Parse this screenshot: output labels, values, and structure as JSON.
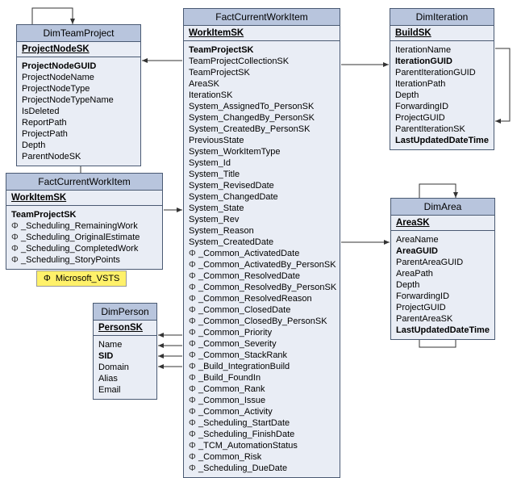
{
  "entities": {
    "dimTeamProject": {
      "title": "DimTeamProject",
      "pk": "ProjectNodeSK",
      "fields": [
        {
          "name": "ProjectNodeGUID",
          "bold": true
        },
        {
          "name": "ProjectNodeName"
        },
        {
          "name": "ProjectNodeType"
        },
        {
          "name": "ProjectNodeTypeName"
        },
        {
          "name": "IsDeleted"
        },
        {
          "name": "ReportPath"
        },
        {
          "name": "ProjectPath"
        },
        {
          "name": "Depth"
        },
        {
          "name": "ParentNodeSK"
        }
      ]
    },
    "factCurrentWorkItemSmall": {
      "title": "FactCurrentWorkItem",
      "pk": "WorkItemSK",
      "header2": "TeamProjectSK",
      "fields": [
        {
          "phi": true,
          "name": "_Scheduling_RemainingWork"
        },
        {
          "phi": true,
          "name": "_Scheduling_OriginalEstimate"
        },
        {
          "phi": true,
          "name": "_Scheduling_CompletedWork"
        },
        {
          "phi": true,
          "name": "_Scheduling_StoryPoints"
        }
      ]
    },
    "factCurrentWorkItemLarge": {
      "title": "FactCurrentWorkItem",
      "pk": "WorkItemSK",
      "header2": "TeamProjectSK",
      "fields": [
        {
          "name": "TeamProjectCollectionSK"
        },
        {
          "name": "TeamProjectSK"
        },
        {
          "name": "AreaSK"
        },
        {
          "name": "IterationSK"
        },
        {
          "name": "System_AssignedTo_PersonSK"
        },
        {
          "name": "System_ChangedBy_PersonSK"
        },
        {
          "name": "System_CreatedBy_PersonSK"
        },
        {
          "name": "PreviousState"
        },
        {
          "name": "System_WorkItemType"
        },
        {
          "name": "System_Id"
        },
        {
          "name": "System_Title"
        },
        {
          "name": "System_RevisedDate"
        },
        {
          "name": "System_ChangedDate"
        },
        {
          "name": "System_State"
        },
        {
          "name": "System_Rev"
        },
        {
          "name": "System_Reason"
        },
        {
          "name": "System_CreatedDate"
        },
        {
          "phi": true,
          "name": "_Common_ActivatedDate"
        },
        {
          "phi": true,
          "name": "_Common_ActivatedBy_PersonSK"
        },
        {
          "phi": true,
          "name": "_Common_ResolvedDate"
        },
        {
          "phi": true,
          "name": "_Common_ResolvedBy_PersonSK"
        },
        {
          "phi": true,
          "name": "_Common_ResolvedReason"
        },
        {
          "phi": true,
          "name": "_Common_ClosedDate"
        },
        {
          "phi": true,
          "name": "_Common_ClosedBy_PersonSK"
        },
        {
          "phi": true,
          "name": "_Common_Priority"
        },
        {
          "phi": true,
          "name": "_Common_Severity"
        },
        {
          "phi": true,
          "name": "_Common_StackRank"
        },
        {
          "phi": true,
          "name": "_Build_IntegrationBuild"
        },
        {
          "phi": true,
          "name": "_Build_FoundIn"
        },
        {
          "phi": true,
          "name": "_Common_Rank"
        },
        {
          "phi": true,
          "name": "_Common_Issue"
        },
        {
          "phi": true,
          "name": "_Common_Activity"
        },
        {
          "phi": true,
          "name": "_Scheduling_StartDate"
        },
        {
          "phi": true,
          "name": "_Scheduling_FinishDate"
        },
        {
          "phi": true,
          "name": "_TCM_AutomationStatus"
        },
        {
          "phi": true,
          "name": "_Common_Risk"
        },
        {
          "phi": true,
          "name": "_Scheduling_DueDate"
        }
      ]
    },
    "dimPerson": {
      "title": "DimPerson",
      "pk": "PersonSK",
      "fields": [
        {
          "name": "Name"
        },
        {
          "name": "SID",
          "bold": true
        },
        {
          "name": "Domain"
        },
        {
          "name": "Alias"
        },
        {
          "name": "Email"
        }
      ]
    },
    "dimIteration": {
      "title": "DimIteration",
      "pk": "BuildSK",
      "fields": [
        {
          "name": "IterationName"
        },
        {
          "name": "IterationGUID",
          "bold": true
        },
        {
          "name": "ParentIterationGUID"
        },
        {
          "name": "IterationPath"
        },
        {
          "name": "Depth"
        },
        {
          "name": "ForwardingID"
        },
        {
          "name": "ProjectGUID"
        },
        {
          "name": "ParentIterationSK"
        },
        {
          "name": "LastUpdatedDateTime",
          "bold": true
        }
      ]
    },
    "dimArea": {
      "title": "DimArea",
      "pk": "AreaSK",
      "fields": [
        {
          "name": "AreaName"
        },
        {
          "name": "AreaGUID",
          "bold": true
        },
        {
          "name": "ParentAreaGUID"
        },
        {
          "name": "AreaPath"
        },
        {
          "name": "Depth"
        },
        {
          "name": "ForwardingID"
        },
        {
          "name": "ProjectGUID"
        },
        {
          "name": "ParentAreaSK"
        },
        {
          "name": "LastUpdatedDateTime",
          "bold": true
        }
      ]
    }
  },
  "legend": {
    "phi": "Φ",
    "text": "Microsoft_VSTS"
  }
}
